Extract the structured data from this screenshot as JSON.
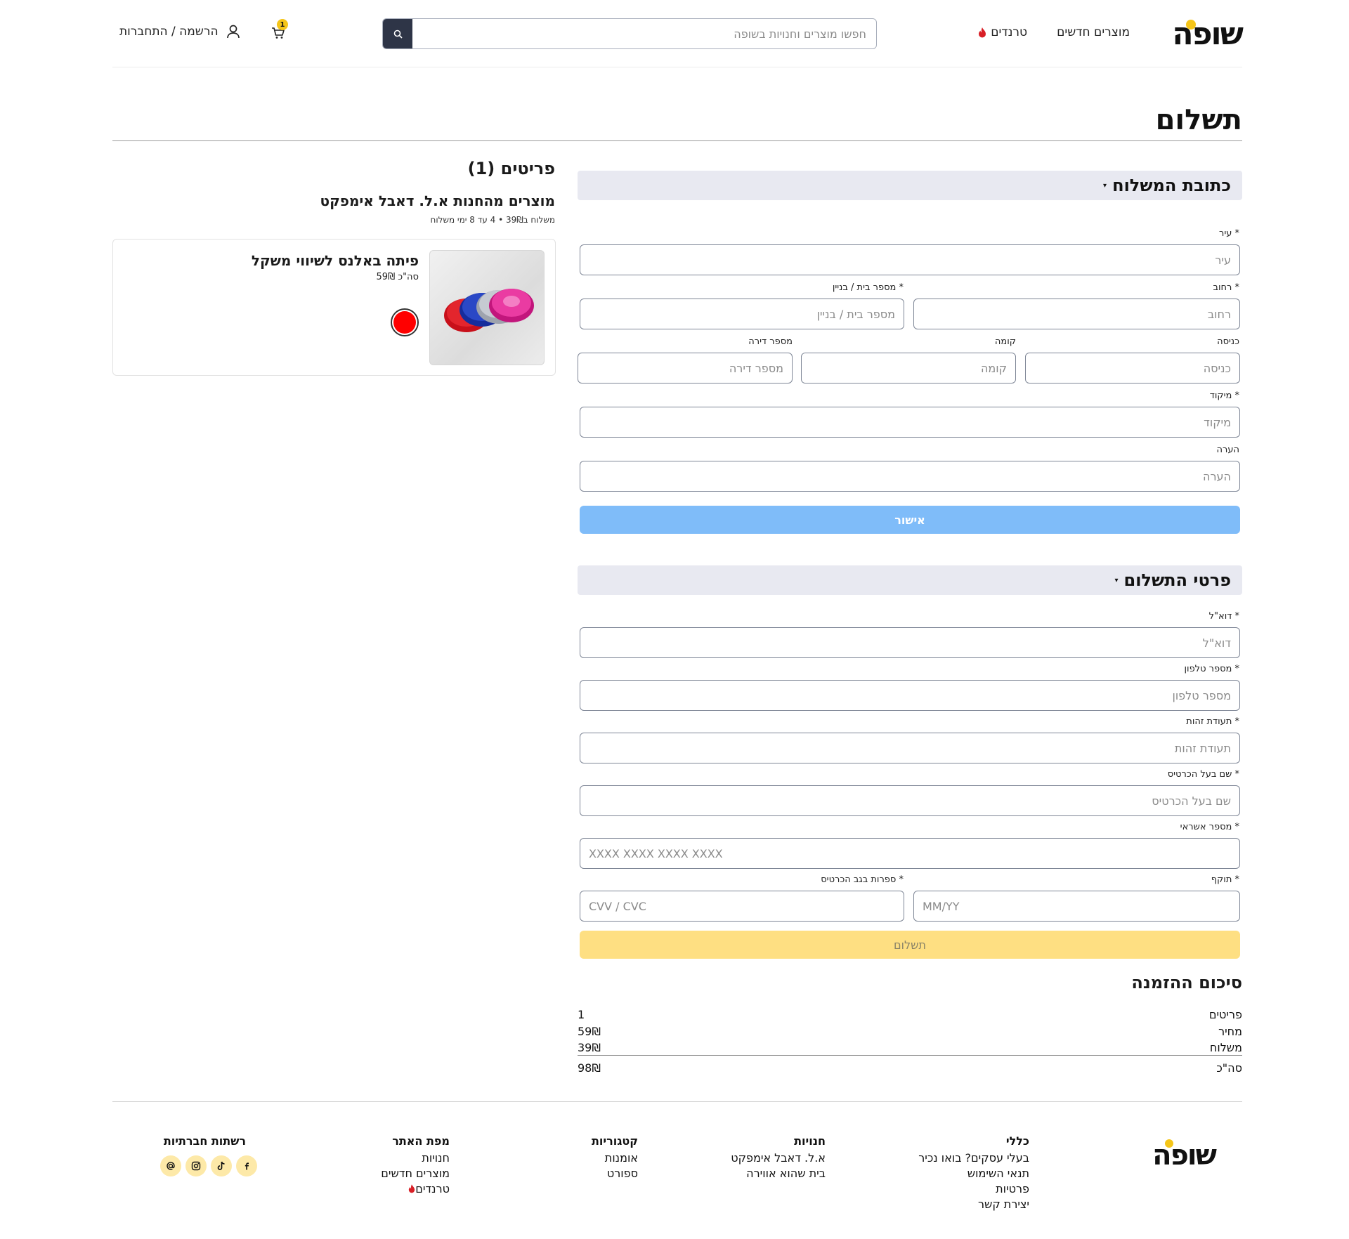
{
  "header": {
    "logo": "שופה",
    "nav_new": "מוצרים חדשים",
    "nav_trends": "טרנדים",
    "search_placeholder": "חפשו מוצרים וחנויות בשופה",
    "cart_count": "1",
    "login_label": "הרשמה / התחברות"
  },
  "page_title": "תשלום",
  "items": {
    "title": "פריטים (1)",
    "store_title": "מוצרים מהחנות א.ל. דאבל אימפקט",
    "shipping_info": "משלוח ב39₪ • 4 עד 8 ימי משלוח",
    "product": {
      "name": "פיתה באלנס לשיווי משקל",
      "total_label": "סה\"כ",
      "total_value": "59₪",
      "color_hex": "#ff0000"
    }
  },
  "shipping_section": {
    "title": "כתובת המשלוח",
    "city_label": "* עיר",
    "city_placeholder": "עיר",
    "street_label": "* רחוב",
    "street_placeholder": "רחוב",
    "house_label": "* מספר בית / בניין",
    "house_placeholder": "מספר בית / בניין",
    "entrance_label": "כניסה",
    "entrance_placeholder": "כניסה",
    "floor_label": "קומה",
    "floor_placeholder": "קומה",
    "apt_label": "מספר דירה",
    "apt_placeholder": "מספר דירה",
    "zip_label": "* מיקוד",
    "zip_placeholder": "מיקוד",
    "note_label": "הערה",
    "note_placeholder": "הערה",
    "approve_button": "אישור"
  },
  "payment_section": {
    "title": "פרטי התשלום",
    "email_label": "* דוא\"ל",
    "email_placeholder": "דוא\"ל",
    "phone_label": "* מספר טלפון",
    "phone_placeholder": "מספר טלפון",
    "id_label": "* תעודת זהות",
    "id_placeholder": "תעודת זהות",
    "holder_label": "* שם בעל הכרטיס",
    "holder_placeholder": "שם בעל הכרטיס",
    "card_label": "* מספר אשראי",
    "card_placeholder": "XXXX XXXX XXXX XXXX",
    "expiry_label": "* תוקף",
    "expiry_placeholder": "MM/YY",
    "cvv_label": "* ספרות בגב הכרטיס",
    "cvv_placeholder": "CVV / CVC",
    "pay_button": "תשלום"
  },
  "summary": {
    "title": "סיכום ההזמנה",
    "rows": [
      {
        "label": "פריטים",
        "value": "1"
      },
      {
        "label": "מחיר",
        "value": "59₪"
      },
      {
        "label": "משלוח",
        "value": "39₪"
      },
      {
        "label": "סה\"כ",
        "value": "98₪"
      }
    ]
  },
  "footer": {
    "logo": "שופה",
    "general": {
      "title": "כללי",
      "links": [
        "בעלי עסקים? בואו נכיר",
        "תנאי השימוש",
        "פרטיות",
        "יצירת קשר"
      ]
    },
    "stores": {
      "title": "חנויות",
      "links": [
        "א.ל. דאבל אימפקט",
        "בית שהוא אווירה"
      ]
    },
    "categories": {
      "title": "קטגוריות",
      "links": [
        "אומנות",
        "ספורט"
      ]
    },
    "sitemap": {
      "title": "מפת האתר",
      "links": [
        "חנויות",
        "מוצרים חדשים",
        "טרנדים"
      ]
    },
    "social": {
      "title": "רשתות חברתיות",
      "icons": [
        "facebook-icon",
        "tiktok-icon",
        "instagram-icon",
        "threads-icon"
      ]
    }
  },
  "colors": {
    "brand_yellow": "#f5c518",
    "approve_blue": "#7fbcf9",
    "pay_yellow": "#fedf82",
    "section_bg": "#e8e9f1",
    "search_btn": "#2e3547"
  }
}
